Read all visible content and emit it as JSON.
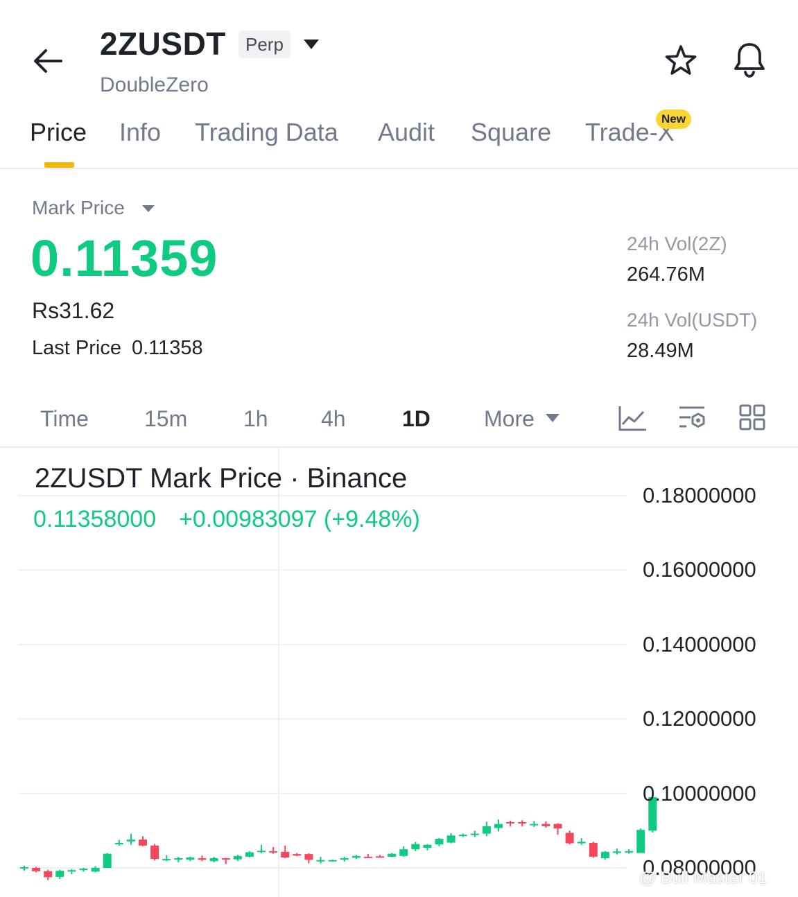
{
  "header": {
    "symbol": "2ZUSDT",
    "badge": "Perp",
    "name": "DoubleZero",
    "icons": [
      "back-arrow-icon",
      "caret-down-icon",
      "star-icon",
      "bell-icon"
    ]
  },
  "tabs": [
    {
      "label": "Price",
      "active": true
    },
    {
      "label": "Info"
    },
    {
      "label": "Trading Data"
    },
    {
      "label": "Audit"
    },
    {
      "label": "Square"
    },
    {
      "label": "Trade-X",
      "badge": "New"
    }
  ],
  "price": {
    "mark_label": "Mark Price",
    "mark_price": "0.11359",
    "fiat": "Rs31.62",
    "last_label": "Last Price",
    "last_value": "0.11358",
    "vol_base_label": "24h Vol(2Z)",
    "vol_base_value": "264.76M",
    "vol_quote_label": "24h Vol(USDT)",
    "vol_quote_value": "28.49M"
  },
  "intervals": {
    "items": [
      "Time",
      "15m",
      "1h",
      "4h",
      "1D"
    ],
    "active": "1D",
    "more": "More",
    "tools": [
      "line-chart-icon",
      "indicator-settings-icon",
      "grid-layout-icon"
    ]
  },
  "colors": {
    "up": "#0ecb81",
    "down": "#f6465d",
    "accent": "#f0b90b"
  },
  "chart_data": {
    "type": "candlestick",
    "title": "2ZUSDT Mark Price · Binance",
    "last_value": "0.11358000",
    "change": "+0.00983097 (+9.48%)",
    "y_ticks": [
      "0.18000000",
      "0.16000000",
      "0.14000000",
      "0.12000000",
      "0.10000000",
      "0.08000000"
    ],
    "ylim": [
      0.078,
      0.184
    ],
    "grid": true,
    "candles": [
      [
        0.08,
        0.0802,
        0.0792,
        0.0806
      ],
      [
        0.08,
        0.0791,
        0.0788,
        0.0803
      ],
      [
        0.0791,
        0.0775,
        0.0767,
        0.0795
      ],
      [
        0.0776,
        0.0792,
        0.077,
        0.0795
      ],
      [
        0.079,
        0.0794,
        0.0783,
        0.0797
      ],
      [
        0.0794,
        0.0798,
        0.079,
        0.08
      ],
      [
        0.079,
        0.08,
        0.0788,
        0.0805
      ],
      [
        0.08,
        0.0838,
        0.08,
        0.084
      ],
      [
        0.0867,
        0.0867,
        0.086,
        0.0875
      ],
      [
        0.0871,
        0.0876,
        0.0862,
        0.0892
      ],
      [
        0.0876,
        0.086,
        0.0858,
        0.0885
      ],
      [
        0.086,
        0.0824,
        0.082,
        0.0864
      ],
      [
        0.0822,
        0.0824,
        0.0818,
        0.0834
      ],
      [
        0.0822,
        0.0826,
        0.0815,
        0.083
      ],
      [
        0.0822,
        0.0828,
        0.0818,
        0.083
      ],
      [
        0.0826,
        0.0822,
        0.0818,
        0.0833
      ],
      [
        0.0818,
        0.0826,
        0.0815,
        0.083
      ],
      [
        0.0826,
        0.0823,
        0.081,
        0.0827
      ],
      [
        0.0823,
        0.0832,
        0.0818,
        0.0835
      ],
      [
        0.083,
        0.0842,
        0.0828,
        0.0845
      ],
      [
        0.0845,
        0.0846,
        0.084,
        0.0862
      ],
      [
        0.0845,
        0.0844,
        0.0838,
        0.0856
      ],
      [
        0.0843,
        0.0828,
        0.0826,
        0.086
      ],
      [
        0.0837,
        0.0833,
        0.0831,
        0.084
      ],
      [
        0.0837,
        0.0822,
        0.0812,
        0.0839
      ],
      [
        0.082,
        0.0821,
        0.0812,
        0.083
      ],
      [
        0.082,
        0.0821,
        0.0817,
        0.0822
      ],
      [
        0.0822,
        0.0826,
        0.0817,
        0.083
      ],
      [
        0.0827,
        0.0832,
        0.0824,
        0.0835
      ],
      [
        0.083,
        0.0829,
        0.0826,
        0.0837
      ],
      [
        0.0831,
        0.083,
        0.0828,
        0.0835
      ],
      [
        0.083,
        0.0838,
        0.0829,
        0.084
      ],
      [
        0.0832,
        0.085,
        0.083,
        0.0858
      ],
      [
        0.085,
        0.0864,
        0.0845,
        0.087
      ],
      [
        0.0854,
        0.0862,
        0.0847,
        0.0864
      ],
      [
        0.0863,
        0.0878,
        0.0858,
        0.088
      ],
      [
        0.0868,
        0.0887,
        0.0866,
        0.0893
      ],
      [
        0.0887,
        0.0889,
        0.0883,
        0.0892
      ],
      [
        0.0891,
        0.0892,
        0.0883,
        0.09
      ],
      [
        0.0892,
        0.0912,
        0.0885,
        0.0924
      ],
      [
        0.0907,
        0.0918,
        0.0898,
        0.093
      ],
      [
        0.0923,
        0.092,
        0.0911,
        0.0927
      ],
      [
        0.0923,
        0.092,
        0.0911,
        0.0928
      ],
      [
        0.0916,
        0.0918,
        0.091,
        0.0926
      ],
      [
        0.0918,
        0.0912,
        0.0908,
        0.0925
      ],
      [
        0.0918,
        0.0906,
        0.0889,
        0.092
      ],
      [
        0.0894,
        0.0866,
        0.0863,
        0.09
      ],
      [
        0.0866,
        0.087,
        0.0862,
        0.088
      ],
      [
        0.0867,
        0.083,
        0.0827,
        0.087
      ],
      [
        0.0826,
        0.0843,
        0.0822,
        0.0845
      ],
      [
        0.0843,
        0.0844,
        0.0836,
        0.0852
      ],
      [
        0.0843,
        0.0845,
        0.0838,
        0.085
      ],
      [
        0.084,
        0.0902,
        0.084,
        0.0906
      ],
      [
        0.09,
        0.099,
        0.0895,
        0.1
      ]
    ]
  },
  "watermark": "@ Bull Master 01"
}
